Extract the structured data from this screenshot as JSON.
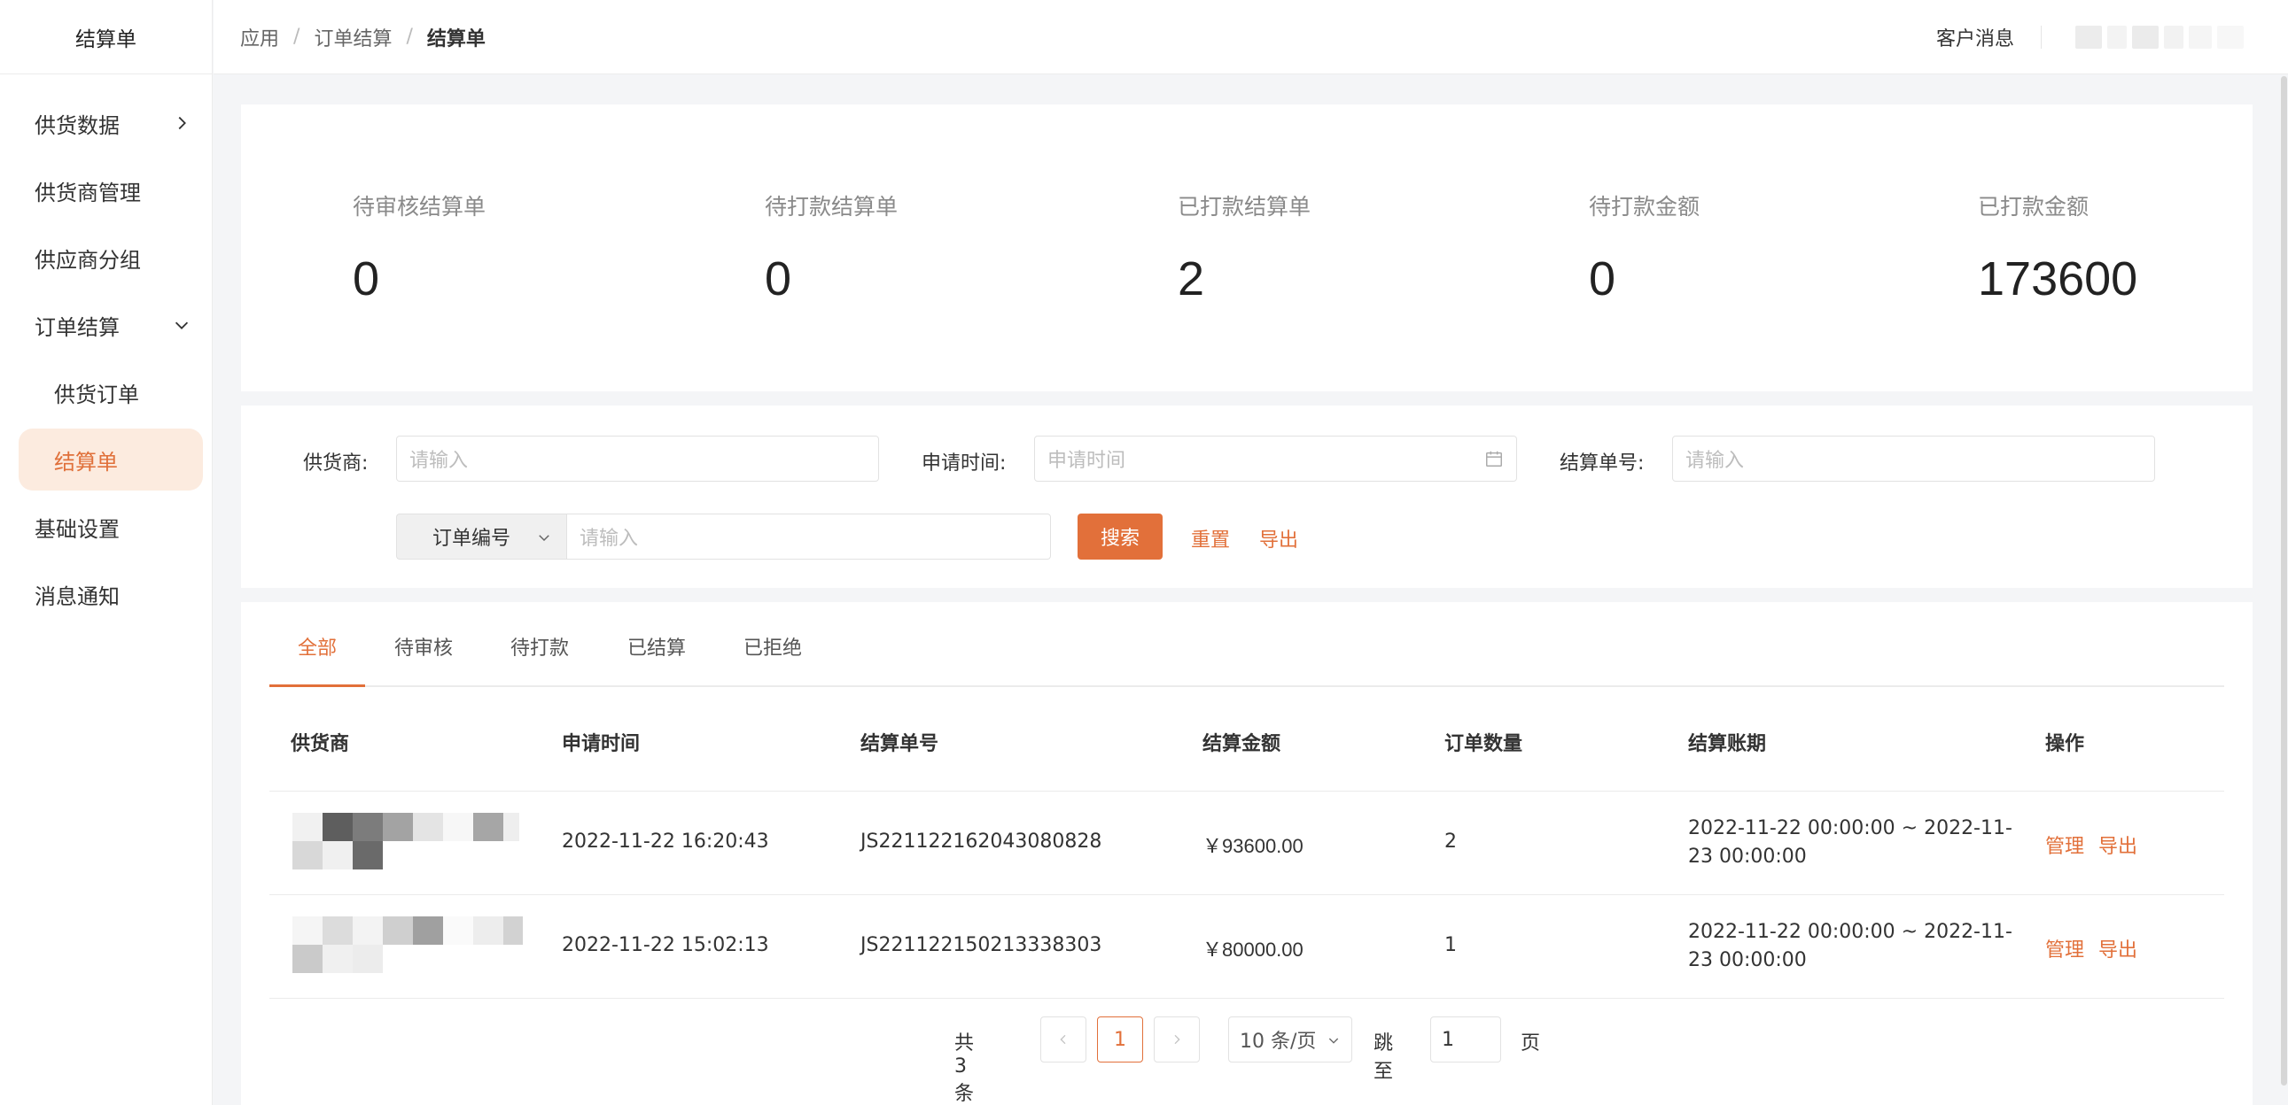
{
  "sidebar": {
    "brand": "结算单",
    "items": [
      {
        "label": "供货数据",
        "arrow": "chevron-right"
      },
      {
        "label": "供货商管理"
      },
      {
        "label": "供应商分组"
      },
      {
        "label": "订单结算",
        "arrow": "chevron-down"
      },
      {
        "label": "供货订单"
      },
      {
        "label": "结算单",
        "active": true
      },
      {
        "label": "基础设置"
      },
      {
        "label": "消息通知"
      }
    ]
  },
  "header": {
    "breadcrumb": [
      "应用",
      "订单结算",
      "结算单"
    ],
    "separator": "/",
    "message": "客户消息"
  },
  "stats": [
    {
      "label": "待审核结算单",
      "value": "0"
    },
    {
      "label": "待打款结算单",
      "value": "0"
    },
    {
      "label": "已打款结算单",
      "value": "2"
    },
    {
      "label": "待打款金额",
      "value": "0"
    },
    {
      "label": "已打款金额",
      "value": "173600"
    }
  ],
  "filter": {
    "supplier_label": "供货商:",
    "supplier_placeholder": "请输入",
    "time_label": "申请时间:",
    "time_placeholder": "申请时间",
    "settle_no_label": "结算单号:",
    "settle_no_placeholder": "请输入",
    "select_value": "订单编号",
    "order_placeholder": "请输入",
    "search": "搜索",
    "reset": "重置",
    "export": "导出"
  },
  "tabs": [
    "全部",
    "待审核",
    "待打款",
    "已结算",
    "已拒绝"
  ],
  "table": {
    "columns": [
      "供货商",
      "申请时间",
      "结算单号",
      "结算金额",
      "订单数量",
      "结算账期",
      "操作"
    ],
    "rows": [
      {
        "time": "2022-11-22 16:20:43",
        "no": "JS221122162043080828",
        "amount": "￥93600.00",
        "count": "2",
        "period": "2022-11-22 00:00:00 ~ 2022-11-23 00:00:00",
        "ops": [
          "管理",
          "导出"
        ]
      },
      {
        "time": "2022-11-22 15:02:13",
        "no": "JS221122150213338303",
        "amount": "￥80000.00",
        "count": "1",
        "period": "2022-11-22 00:00:00 ~ 2022-11-23 00:00:00",
        "ops": [
          "管理",
          "导出"
        ]
      }
    ]
  },
  "pagination": {
    "total": "共 3 条",
    "current": "1",
    "size": "10 条/页",
    "goto": "跳至",
    "goto_value": "1",
    "page": "页"
  },
  "colors": {
    "accent": "#e2703a",
    "active_bg": "#fcebdf"
  }
}
